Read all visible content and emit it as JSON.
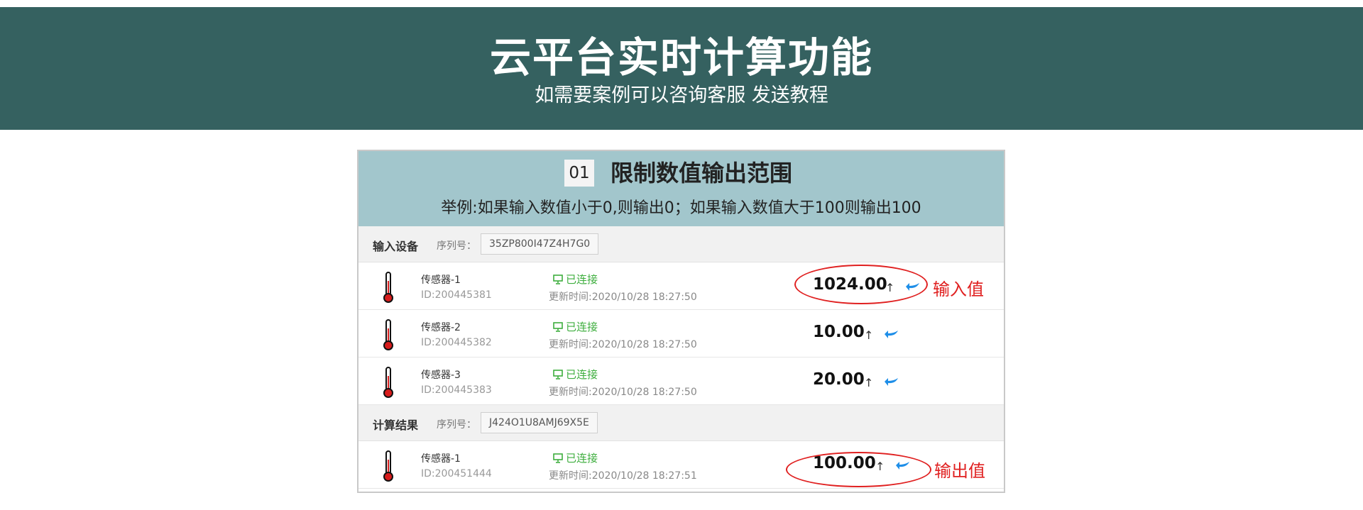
{
  "banner": {
    "title": "云平台实时计算功能",
    "subtitle": "如需要案例可以咨询客服 发送教程"
  },
  "card": {
    "number": "01",
    "title": "限制数值输出范围",
    "description": "举例:如果输入数值小于0,则输出0；如果输入数值大于100则输出100"
  },
  "input_section": {
    "label": "输入设备",
    "serial_label": "序列号：",
    "serial": "35ZP800I47Z4H7G0"
  },
  "input_devices": [
    {
      "name": "传感器-1",
      "id": "ID:200445381",
      "status": "已连接",
      "updated": "更新时间:2020/10/28 18:27:50",
      "value": "1024.00",
      "annotation": "输入值"
    },
    {
      "name": "传感器-2",
      "id": "ID:200445382",
      "status": "已连接",
      "updated": "更新时间:2020/10/28 18:27:50",
      "value": "10.00"
    },
    {
      "name": "传感器-3",
      "id": "ID:200445383",
      "status": "已连接",
      "updated": "更新时间:2020/10/28 18:27:50",
      "value": "20.00"
    }
  ],
  "result_section": {
    "label": "计算结果",
    "serial_label": "序列号：",
    "serial": "J424O1U8AMJ69X5E"
  },
  "result_devices": [
    {
      "name": "传感器-1",
      "id": "ID:200451444",
      "status": "已连接",
      "updated": "更新时间:2020/10/28 18:27:51",
      "value": "100.00",
      "annotation": "输出值"
    }
  ],
  "icons": {
    "sensor": "thermometer-icon",
    "status": "monitor-icon",
    "trend": "arrow-up-icon",
    "action": "reply-arrow-icon"
  },
  "colors": {
    "banner": "#356160",
    "card_header": "#a2c6cc",
    "connected": "#3eae3e",
    "annotation": "#e02020",
    "reply_arrow": "#1e8ee8"
  }
}
